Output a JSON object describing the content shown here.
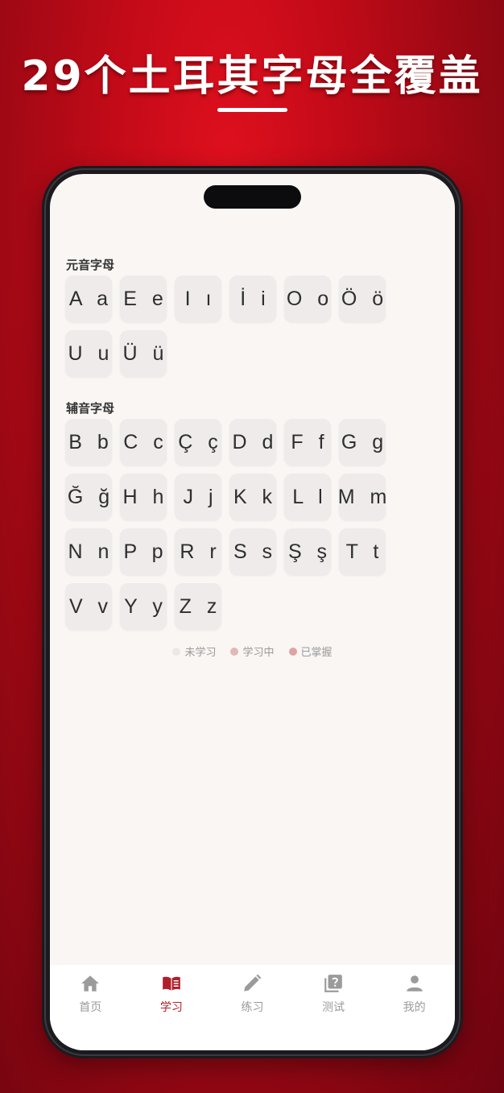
{
  "headline": "29个土耳其字母全覆盖",
  "vowels": {
    "title": "元音字母",
    "letters": [
      "A a",
      "E e",
      "I ı",
      "İ i",
      "O o",
      "Ö ö",
      "U u",
      "Ü ü"
    ]
  },
  "consonants": {
    "title": "辅音字母",
    "letters": [
      "B b",
      "C c",
      "Ç ç",
      "D d",
      "F f",
      "G g",
      "Ğ ğ",
      "H h",
      "J j",
      "K k",
      "L l",
      "M m",
      "N n",
      "P p",
      "R r",
      "S s",
      "Ş ş",
      "T t",
      "V v",
      "Y y",
      "Z z"
    ]
  },
  "legend": [
    {
      "label": "未学习",
      "color": "#ebe8e6"
    },
    {
      "label": "学习中",
      "color": "#e0b8b8"
    },
    {
      "label": "已掌握",
      "color": "#dfa3a6"
    }
  ],
  "tabs": [
    {
      "label": "首页",
      "icon": "home-icon",
      "active": false
    },
    {
      "label": "学习",
      "icon": "book-icon",
      "active": true
    },
    {
      "label": "练习",
      "icon": "pencil-icon",
      "active": false
    },
    {
      "label": "测试",
      "icon": "quiz-icon",
      "active": false
    },
    {
      "label": "我的",
      "icon": "person-icon",
      "active": false
    }
  ],
  "colors": {
    "accent": "#b0202a",
    "background_red": "#c20a18",
    "screen_bg": "#f9f6f4",
    "tile_bg": "#eeebea"
  }
}
